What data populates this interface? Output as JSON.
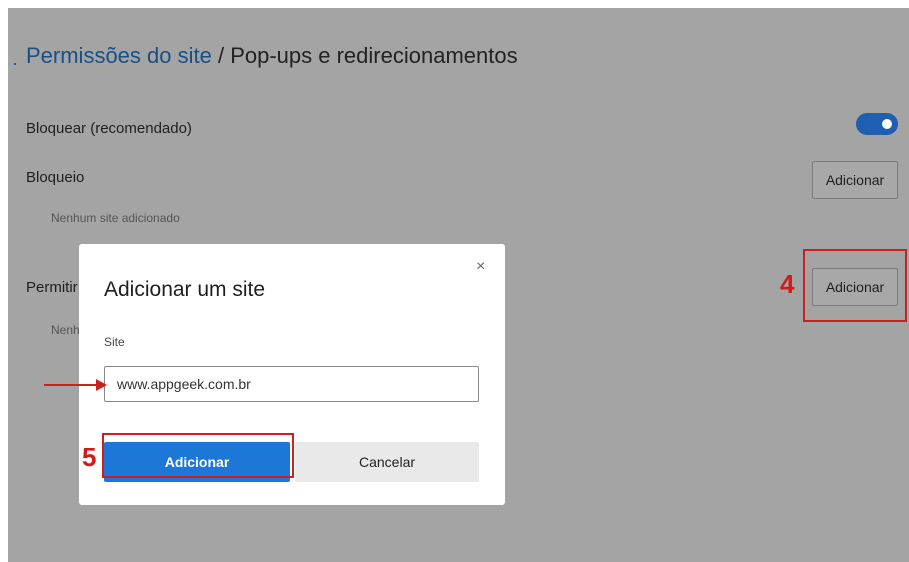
{
  "header": {
    "breadcrumb_link": "Permissões do site",
    "separator": " / ",
    "page_title": "Pop-ups e redirecionamentos"
  },
  "block_setting": {
    "label": "Bloquear (recomendado)",
    "toggle_on": true
  },
  "block_list": {
    "label": "Bloqueio",
    "empty_text": "Nenhum site adicionado",
    "add_button": "Adicionar"
  },
  "allow_list": {
    "label_visible": "Permitir",
    "empty_text_visible": "Nenh",
    "add_button": "Adicionar"
  },
  "dialog": {
    "title": "Adicionar um site",
    "close_glyph": "×",
    "field_label": "Site",
    "field_value": "www.appgeek.com.br",
    "primary_button": "Adicionar",
    "secondary_button": "Cancelar"
  },
  "annotations": {
    "step_4": "4",
    "step_5": "5",
    "highlight_color": "#cc1f1f"
  },
  "colors": {
    "accent": "#1d77d6",
    "toggle": "#1e5fb3",
    "link": "#1a4f86",
    "overlay": "#a4a4a4"
  }
}
